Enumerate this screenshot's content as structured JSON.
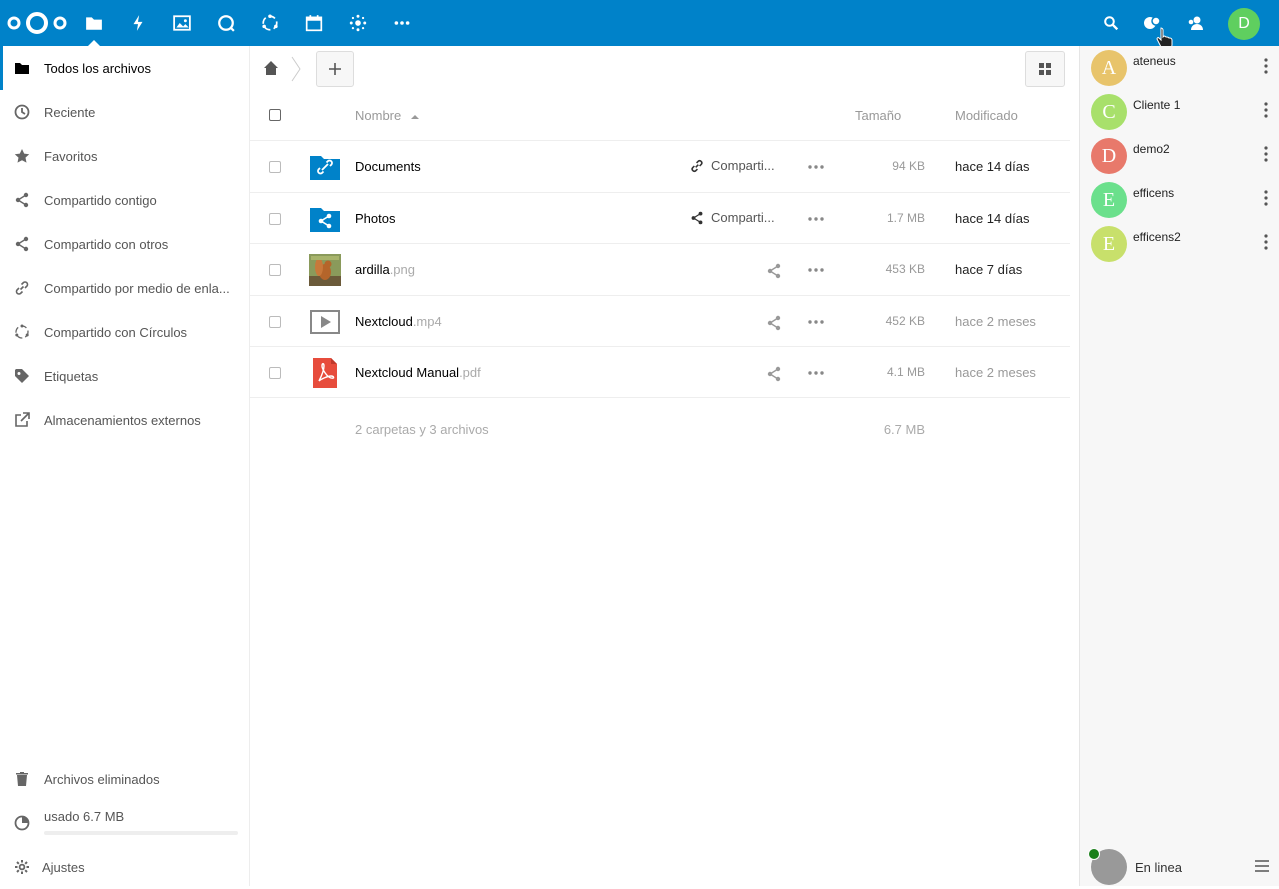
{
  "topbar": {
    "apps": [
      {
        "name": "files-app-icon",
        "active": true
      },
      {
        "name": "activity-app-icon"
      },
      {
        "name": "gallery-app-icon"
      },
      {
        "name": "talk-app-icon"
      },
      {
        "name": "circles-app-icon"
      },
      {
        "name": "calendar-app-icon"
      },
      {
        "name": "social-app-icon"
      },
      {
        "name": "more-apps-icon"
      }
    ],
    "user_initial": "D",
    "brand_color": "#0082c9"
  },
  "sidebar": {
    "items": [
      {
        "label": "Todos los archivos",
        "icon": "folder-icon"
      },
      {
        "label": "Reciente",
        "icon": "clock-icon"
      },
      {
        "label": "Favoritos",
        "icon": "star-icon"
      },
      {
        "label": "Compartido contigo",
        "icon": "share-icon"
      },
      {
        "label": "Compartido con otros",
        "icon": "share-icon"
      },
      {
        "label": "Compartido por medio de enla...",
        "icon": "link-icon"
      },
      {
        "label": "Compartido con Círculos",
        "icon": "circles-icon"
      },
      {
        "label": "Etiquetas",
        "icon": "tag-icon"
      },
      {
        "label": "Almacenamientos externos",
        "icon": "external-icon"
      }
    ],
    "trash_label": "Archivos eliminados",
    "usage_label": "usado 6.7 MB",
    "usage_fraction": 0.0,
    "settings_label": "Ajustes"
  },
  "files": {
    "header": {
      "name": "Nombre",
      "size": "Tamaño",
      "modified": "Modificado"
    },
    "rows": [
      {
        "name": "Documents",
        "ext": "",
        "share": "Comparti...",
        "size": "94 KB",
        "modified": "hace 14 días",
        "type": "folder-link"
      },
      {
        "name": "Photos",
        "ext": "",
        "share": "Comparti...",
        "size": "1.7 MB",
        "modified": "hace 14 días",
        "type": "folder-share"
      },
      {
        "name": "ardilla",
        "ext": ".png",
        "share": "",
        "size": "453 KB",
        "modified": "hace 7 días",
        "type": "image"
      },
      {
        "name": "Nextcloud",
        "ext": ".mp4",
        "share": "",
        "size": "452 KB",
        "modified": "hace 2 meses",
        "type": "video"
      },
      {
        "name": "Nextcloud Manual",
        "ext": ".pdf",
        "share": "",
        "size": "4.1 MB",
        "modified": "hace 2 meses",
        "type": "pdf"
      }
    ],
    "summary": "2 carpetas y 3 archivos",
    "summary_size": "6.7 MB"
  },
  "contacts": [
    {
      "initial": "A",
      "name": "ateneus",
      "color": "#e8c46b"
    },
    {
      "initial": "C",
      "name": "Cliente 1",
      "color": "#a8e06b"
    },
    {
      "initial": "D",
      "name": "demo2",
      "color": "#e8796b"
    },
    {
      "initial": "E",
      "name": "efficens",
      "color": "#6be08c"
    },
    {
      "initial": "E",
      "name": "efficens2",
      "color": "#c8e06b"
    }
  ],
  "status": {
    "label": "En linea"
  }
}
